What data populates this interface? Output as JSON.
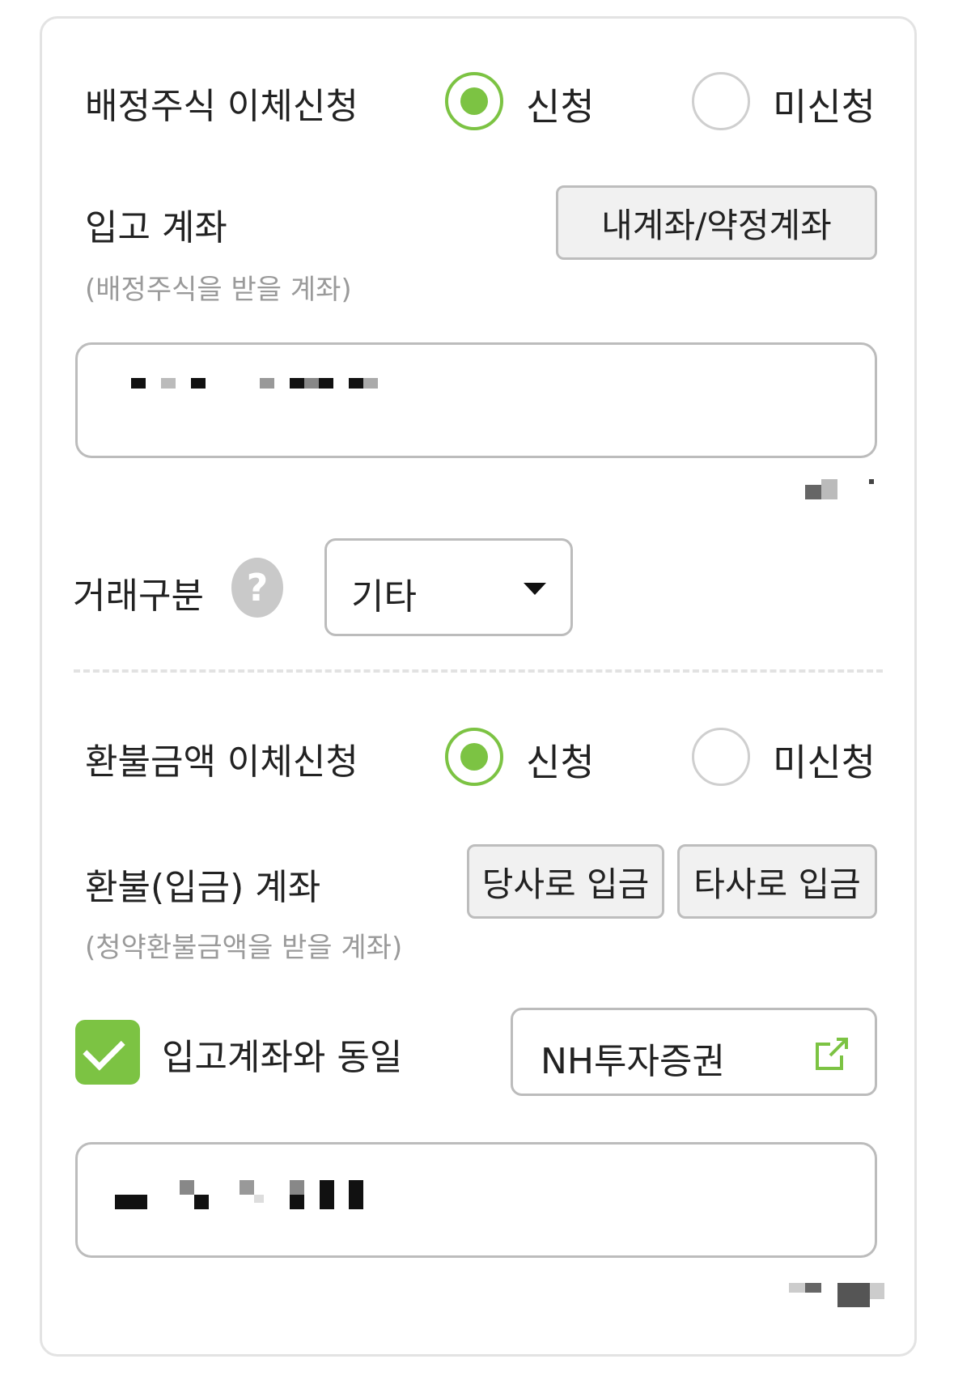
{
  "stock_transfer": {
    "label": "배정주식 이체신청",
    "options": [
      "신청",
      "미신청"
    ],
    "selected": "신청"
  },
  "deposit_account": {
    "label": "입고 계좌",
    "sub_label": "(배정주식을 받을 계좌)",
    "button_label": "내계좌/약정계좌"
  },
  "trade_type": {
    "label": "거래구분",
    "help_icon": "?",
    "select_value": "기타"
  },
  "refund_transfer": {
    "label": "환불금액 이체신청",
    "options": [
      "신청",
      "미신청"
    ],
    "selected": "신청"
  },
  "refund_account": {
    "label": "환불(입금) 계좌",
    "sub_label": "(청약환불금액을 받을 계좌)",
    "own_company_button": "당사로 입금",
    "other_company_button": "타사로 입금",
    "same_as_deposit_label": "입고계좌와 동일",
    "same_as_deposit_checked": true,
    "broker_name": "NH투자증권"
  },
  "colors": {
    "accent": "#7cc343",
    "border": "#bcbcbc",
    "muted": "#9a9a9a"
  },
  "icons": [
    "radio-selected-icon",
    "help-icon",
    "dropdown-arrow-icon",
    "checkmark-icon",
    "external-link-icon"
  ]
}
